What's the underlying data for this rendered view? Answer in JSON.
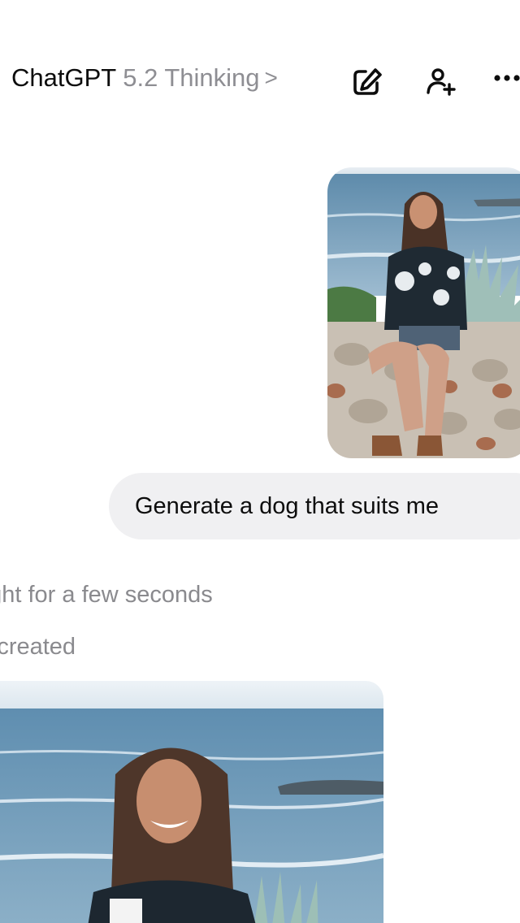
{
  "header": {
    "app_name": "ChatGPT",
    "model_name": "5.2 Thinking",
    "chevron": ">",
    "icons": [
      "edit-icon",
      "add-person-icon",
      "more-options-icon"
    ]
  },
  "conversation": {
    "user_image": {
      "description_icon": "user-uploaded-photo"
    },
    "user_message": "Generate a dog that suits me",
    "assistant_status": [
      "ught for a few seconds",
      "ge created"
    ],
    "generated_image": {
      "description_icon": "generated-image"
    }
  },
  "colors": {
    "text_primary": "#0d0d0d",
    "text_secondary": "#8e8e93",
    "bubble_bg": "#f0f0f2",
    "background": "#ffffff"
  }
}
